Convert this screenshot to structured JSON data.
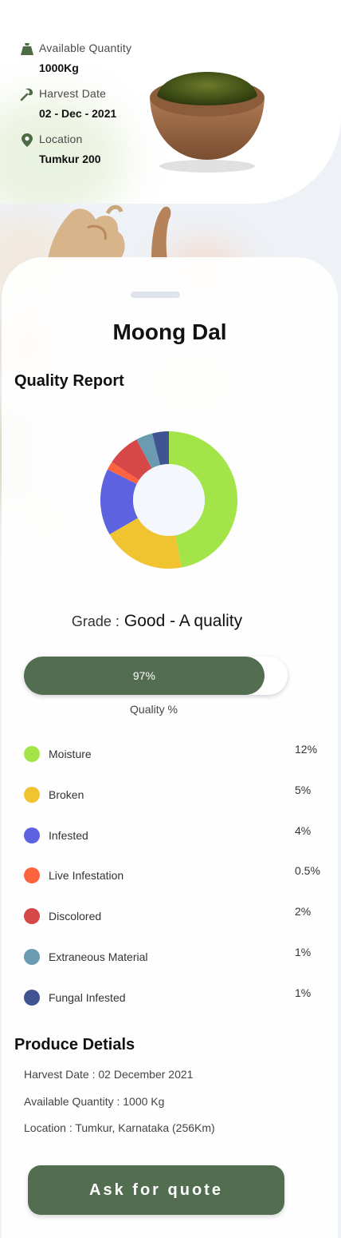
{
  "product": {
    "quantity_label": "Available Quantity",
    "quantity_value": "1000Kg",
    "harvest_label": "Harvest Date",
    "harvest_value": "02 - Dec - 2021",
    "location_label": "Location",
    "location_value": "Tumkur 200",
    "name": "Moong Dal"
  },
  "quality": {
    "section_title": "Quality Report",
    "grade_label": "Grade :",
    "grade_value": "Good - A quality",
    "percent": 97,
    "percent_label": "97%",
    "percent_caption": "Quality %"
  },
  "chart_data": {
    "type": "pie",
    "style": "donut",
    "slices": [
      {
        "name": "Moisture",
        "value": 12,
        "color": "#a3e448"
      },
      {
        "name": "Broken",
        "value": 5,
        "color": "#f0c331"
      },
      {
        "name": "Infested",
        "value": 4,
        "color": "#5d62e0"
      },
      {
        "name": "Live Infestation",
        "value": 0.5,
        "color": "#fe6340"
      },
      {
        "name": "Discolored",
        "value": 2,
        "color": "#d64747"
      },
      {
        "name": "Extraneous Material",
        "value": 1,
        "color": "#6a9bb0"
      },
      {
        "name": "Fungal Infested",
        "value": 1,
        "color": "#3f5490"
      }
    ]
  },
  "legend": [
    {
      "name": "Moisture",
      "pct": "12%",
      "color": "#a3e448"
    },
    {
      "name": "Broken",
      "pct": "5%",
      "color": "#f0c331"
    },
    {
      "name": "Infested",
      "pct": "4%",
      "color": "#5d62e0"
    },
    {
      "name": "Live Infestation",
      "pct": "0.5%",
      "color": "#fe6340"
    },
    {
      "name": "Discolored",
      "pct": "2%",
      "color": "#d64747"
    },
    {
      "name": "Extraneous Material",
      "pct": "1%",
      "color": "#6a9bb0"
    },
    {
      "name": "Fungal Infested",
      "pct": "1%",
      "color": "#3f5490"
    }
  ],
  "produce": {
    "section_title": "Produce Detials",
    "harvest_date": "Harvest Date : 02 December 2021",
    "available_quantity": "Available Quantity : 1000 Kg",
    "location": "Location : Tumkur, Karnataka (256Km)"
  },
  "actions": {
    "quote_label": "Ask for quote"
  },
  "icons": {
    "quantity": "weight-bag-icon",
    "harvest": "sickle-icon",
    "location": "location-pin-icon"
  },
  "colors": {
    "brand": "#526d50"
  }
}
